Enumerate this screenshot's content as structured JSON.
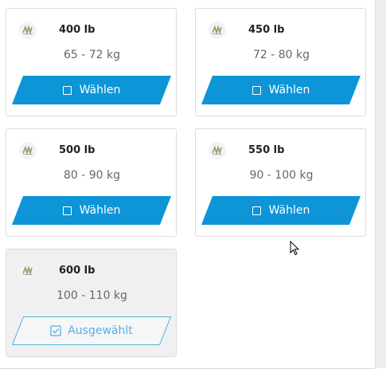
{
  "options": [
    {
      "weight": "400 lb",
      "range": "65 - 72 kg",
      "button_label": "Wählen",
      "selected": false
    },
    {
      "weight": "450 lb",
      "range": "72 - 80 kg",
      "button_label": "Wählen",
      "selected": false
    },
    {
      "weight": "500 lb",
      "range": "80 - 90 kg",
      "button_label": "Wählen",
      "selected": false
    },
    {
      "weight": "550 lb",
      "range": "90 - 100 kg",
      "button_label": "Wählen",
      "selected": false
    },
    {
      "weight": "600 lb",
      "range": "100 - 110 kg",
      "button_label": "Ausgewählt",
      "selected": true
    }
  ],
  "colors": {
    "accent": "#0d95d8",
    "accent_outline": "#4fb3e3",
    "selected_card_bg": "#f0f0f0"
  },
  "icons": {
    "product_thumbnail": "spring-icon",
    "choose": "checkbox-empty-icon",
    "chosen": "checkbox-checked-icon"
  }
}
